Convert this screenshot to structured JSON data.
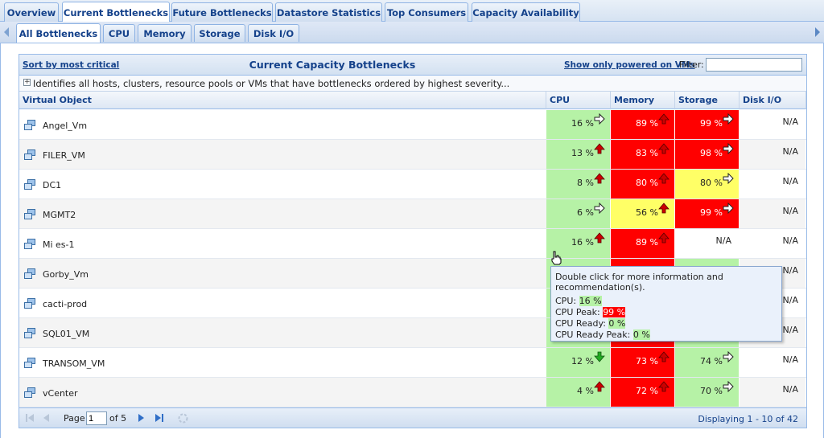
{
  "top_tabs": [
    {
      "label": "Overview"
    },
    {
      "label": "Current Bottlenecks"
    },
    {
      "label": "Future Bottlenecks"
    },
    {
      "label": "Datastore Statistics"
    },
    {
      "label": "Top Consumers"
    },
    {
      "label": "Capacity Availability"
    }
  ],
  "sub_tabs": [
    {
      "label": "All Bottlenecks"
    },
    {
      "label": "CPU"
    },
    {
      "label": "Memory"
    },
    {
      "label": "Storage"
    },
    {
      "label": "Disk I/O"
    }
  ],
  "panel": {
    "sort_link": "Sort by most critical",
    "title": "Current Capacity Bottlenecks",
    "powered_link": "Show only powered on VMs",
    "filter_label": "Filter:",
    "filter_value": "",
    "description": "Identifies all hosts, clusters, resource pools or VMs that have bottlenecks ordered by highest severity..."
  },
  "columns": [
    "Virtual Object",
    "CPU",
    "Memory",
    "Storage",
    "Disk I/O"
  ],
  "rows": [
    {
      "name": "Angel_Vm",
      "cpu": {
        "v": "16 %",
        "c": "green",
        "a": "right"
      },
      "mem": {
        "v": "89 %",
        "c": "red",
        "a": "up"
      },
      "sto": {
        "v": "99 %",
        "c": "red",
        "a": "right"
      },
      "disk": {
        "v": "N/A",
        "c": "white",
        "a": ""
      }
    },
    {
      "name": "FILER_VM",
      "cpu": {
        "v": "13 %",
        "c": "green",
        "a": "up"
      },
      "mem": {
        "v": "83 %",
        "c": "red",
        "a": "up"
      },
      "sto": {
        "v": "98 %",
        "c": "red",
        "a": "right"
      },
      "disk": {
        "v": "N/A",
        "c": "white",
        "a": ""
      }
    },
    {
      "name": "DC1",
      "cpu": {
        "v": "8 %",
        "c": "green",
        "a": "up"
      },
      "mem": {
        "v": "80 %",
        "c": "red",
        "a": "up"
      },
      "sto": {
        "v": "80 %",
        "c": "yellow",
        "a": "right"
      },
      "disk": {
        "v": "N/A",
        "c": "white",
        "a": ""
      }
    },
    {
      "name": "MGMT2",
      "cpu": {
        "v": "6 %",
        "c": "green",
        "a": "right"
      },
      "mem": {
        "v": "56 %",
        "c": "yellow",
        "a": "up"
      },
      "sto": {
        "v": "99 %",
        "c": "red",
        "a": "right"
      },
      "disk": {
        "v": "N/A",
        "c": "white",
        "a": ""
      }
    },
    {
      "name": "Mi          es-1",
      "cpu": {
        "v": "16 %",
        "c": "green",
        "a": "up"
      },
      "mem": {
        "v": "89 %",
        "c": "red",
        "a": "up"
      },
      "sto": {
        "v": "N/A",
        "c": "white",
        "a": ""
      },
      "disk": {
        "v": "N/A",
        "c": "white",
        "a": ""
      }
    },
    {
      "name": "Gorby_Vm",
      "cpu": {
        "v": "",
        "c": "green",
        "a": ""
      },
      "mem": {
        "v": "",
        "c": "red",
        "a": ""
      },
      "sto": {
        "v": "",
        "c": "green",
        "a": ""
      },
      "disk": {
        "v": "N/A",
        "c": "white",
        "a": ""
      }
    },
    {
      "name": "cacti-prod",
      "cpu": {
        "v": "",
        "c": "green",
        "a": ""
      },
      "mem": {
        "v": "",
        "c": "red",
        "a": ""
      },
      "sto": {
        "v": "",
        "c": "green",
        "a": ""
      },
      "disk": {
        "v": "N/A",
        "c": "white",
        "a": ""
      }
    },
    {
      "name": "SQL01_VM",
      "cpu": {
        "v": "",
        "c": "green",
        "a": ""
      },
      "mem": {
        "v": "",
        "c": "red",
        "a": ""
      },
      "sto": {
        "v": "",
        "c": "green",
        "a": ""
      },
      "disk": {
        "v": "N/A",
        "c": "white",
        "a": ""
      }
    },
    {
      "name": "TRANSOM_VM",
      "cpu": {
        "v": "12 %",
        "c": "green",
        "a": "down"
      },
      "mem": {
        "v": "73 %",
        "c": "red",
        "a": "up"
      },
      "sto": {
        "v": "74 %",
        "c": "green",
        "a": "right"
      },
      "disk": {
        "v": "N/A",
        "c": "white",
        "a": ""
      }
    },
    {
      "name": "vCenter",
      "cpu": {
        "v": "4 %",
        "c": "green",
        "a": "up"
      },
      "mem": {
        "v": "72 %",
        "c": "red",
        "a": "up"
      },
      "sto": {
        "v": "70 %",
        "c": "green",
        "a": "right"
      },
      "disk": {
        "v": "N/A",
        "c": "white",
        "a": ""
      }
    }
  ],
  "pager": {
    "page_label": "Page",
    "page_value": "1",
    "of_label": "of 5",
    "display_info": "Displaying 1 - 10 of 42"
  },
  "tooltip": {
    "hint": "Double click for more information and recommendation(s).",
    "lines": [
      {
        "label": "CPU:",
        "value": "16 %",
        "hl": "green"
      },
      {
        "label": "CPU Peak:",
        "value": "99 %",
        "hl": "red"
      },
      {
        "label": "CPU Ready:",
        "value": "0 %",
        "hl": "green"
      },
      {
        "label": "CPU Ready Peak:",
        "value": "0 %",
        "hl": "green"
      }
    ]
  },
  "colors": {
    "green": "#b6f2a6",
    "red": "#ff0000",
    "yellow": "#ffff66",
    "accent": "#15428b"
  }
}
